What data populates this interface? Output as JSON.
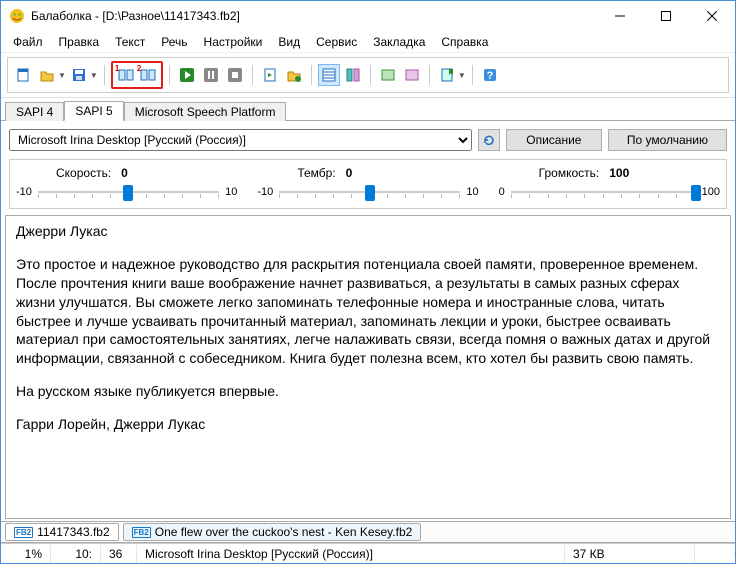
{
  "window": {
    "title": "Балаболка - [D:\\Разное\\11417343.fb2]"
  },
  "menu": [
    "Файл",
    "Правка",
    "Текст",
    "Речь",
    "Настройки",
    "Вид",
    "Сервис",
    "Закладка",
    "Справка"
  ],
  "tabs": {
    "items": [
      "SAPI 4",
      "SAPI 5",
      "Microsoft Speech Platform"
    ],
    "active": 1
  },
  "voice": {
    "selected": "Microsoft Irina Desktop [Русский (Россия)]",
    "desc_btn": "Описание",
    "default_btn": "По умолчанию"
  },
  "sliders": {
    "speed": {
      "label": "Скорость:",
      "value": "0",
      "min": "-10",
      "max": "10",
      "pos": 50
    },
    "pitch": {
      "label": "Тембр:",
      "value": "0",
      "min": "-10",
      "max": "10",
      "pos": 50
    },
    "volume": {
      "label": "Громкость:",
      "value": "100",
      "min": "0",
      "max": "100",
      "pos": 100
    }
  },
  "document": {
    "heading": "Джерри Лукас",
    "body": "Это простое и надежное руководство для раскрытия потенциала своей памяти, проверенное временем. После прочтения книги ваше воображение начнет развиваться, а результаты в самых разных сферах жизни улучшатся. Вы сможете легко запоминать телефонные номера и иностранные слова, читать быстрее и лучше усваивать прочитанный материал, запоминать лекции и уроки, быстрее осваивать материал при самостоятельных занятиях, легче налаживать связи, всегда помня о важных датах и другой информации, связанной с собеседником. Книга будет полезна всем, кто хотел бы развить свою память.",
    "note": "На русском языке публикуется впервые.",
    "footer": "Гарри Лорейн, Джерри Лукас"
  },
  "doctabs": [
    {
      "label": "11417343.fb2",
      "active": true
    },
    {
      "label": "One flew over the cuckoo's nest - Ken Kesey.fb2",
      "active": false
    }
  ],
  "status": {
    "percent": "1%",
    "line": "10:",
    "col": "36",
    "voice": "Microsoft Irina Desktop [Русский (Россия)]",
    "size": "37 КВ"
  }
}
